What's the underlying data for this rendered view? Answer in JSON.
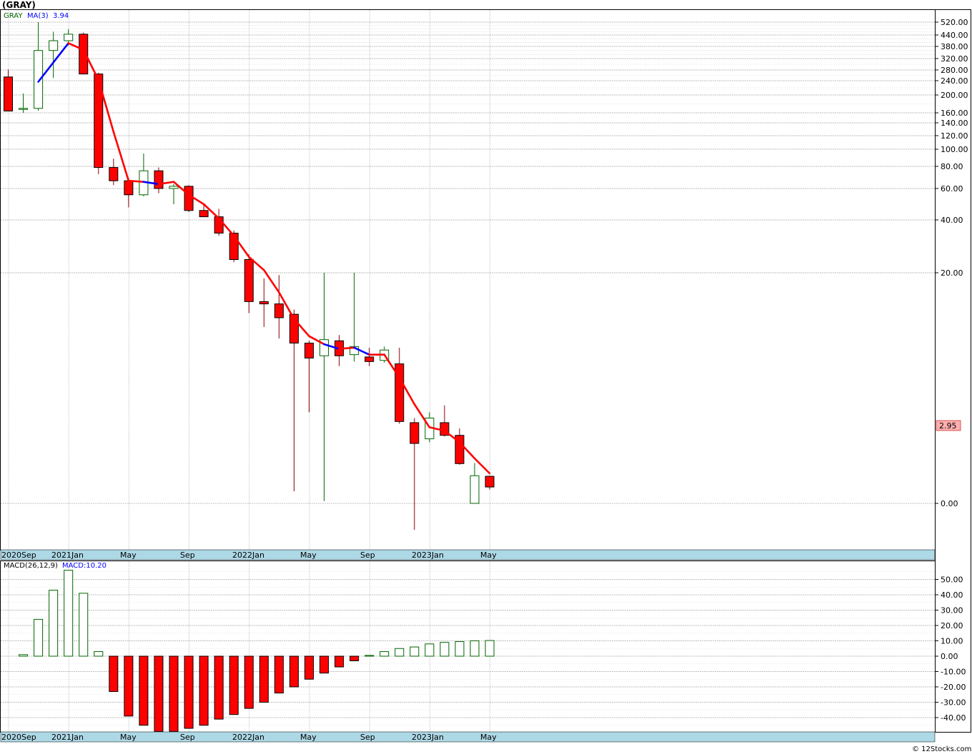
{
  "title": "(GRAY)",
  "legend": {
    "symbol": "GRAY",
    "ma_label": "MA(3)",
    "ma_value": "3.94"
  },
  "macd_legend": {
    "label": "MACD(26,12,9)",
    "value_label": "MACD:10.20"
  },
  "last_price_label": "2.95",
  "footer": "© 12Stocks.com",
  "colors": {
    "up": "#006400",
    "down": "#ff0000",
    "ma_up": "#0000ff",
    "ma_down": "#ff0000",
    "axis_band": "#add8e6",
    "grid": "#c8c8c8"
  },
  "chart_data": [
    {
      "type": "candlestick",
      "title": "(GRAY)",
      "y_tick_labels": [
        "520.00",
        "440.00",
        "380.00",
        "320.00",
        "280.00",
        "240.00",
        "200.00",
        "160.00",
        "140.00",
        "120.00",
        "100.00",
        "80.00",
        "60.00",
        "40.00",
        "20.00",
        "0.00"
      ],
      "x_tick_labels": [
        "2020Sep",
        "2021Jan",
        "May",
        "Sep",
        "2022Jan",
        "May",
        "Sep",
        "2023Jan",
        "May"
      ],
      "ma_label": "MA(3)",
      "candles": [
        {
          "period": "2020-09",
          "open": 254,
          "high": 282,
          "low": 164,
          "close": 164
        },
        {
          "period": "2020-10",
          "open": 170,
          "high": 204,
          "low": 160,
          "close": 170
        },
        {
          "period": "2020-11",
          "open": 170,
          "high": 520,
          "low": 165,
          "close": 360
        },
        {
          "period": "2020-12",
          "open": 360,
          "high": 460,
          "low": 250,
          "close": 410
        },
        {
          "period": "2021-01",
          "open": 410,
          "high": 476,
          "low": 385,
          "close": 445
        },
        {
          "period": "2021-02",
          "open": 445,
          "high": 455,
          "low": 265,
          "close": 265
        },
        {
          "period": "2021-03",
          "open": 265,
          "high": 270,
          "low": 73,
          "close": 79
        },
        {
          "period": "2021-04",
          "open": 79,
          "high": 89,
          "low": 63,
          "close": 67
        },
        {
          "period": "2021-05",
          "open": 67,
          "high": 69,
          "low": 48,
          "close": 56
        },
        {
          "period": "2021-06",
          "open": 56,
          "high": 95,
          "low": 55,
          "close": 76
        },
        {
          "period": "2021-07",
          "open": 76,
          "high": 79,
          "low": 57,
          "close": 60
        },
        {
          "period": "2021-08",
          "open": 60,
          "high": 64,
          "low": 50,
          "close": 62
        },
        {
          "period": "2021-09",
          "open": 62,
          "high": 63,
          "low": 45,
          "close": 46
        },
        {
          "period": "2021-10",
          "open": 46,
          "high": 50,
          "low": 42,
          "close": 42
        },
        {
          "period": "2021-11",
          "open": 42,
          "high": 47,
          "low": 34,
          "close": 35
        },
        {
          "period": "2021-12",
          "open": 35,
          "high": 36,
          "low": 24,
          "close": 25
        },
        {
          "period": "2022-01",
          "open": 25,
          "high": 27,
          "low": 16.5,
          "close": 17.5
        },
        {
          "period": "2022-02",
          "open": 17.5,
          "high": 19.5,
          "low": 15.3,
          "close": 17.3
        },
        {
          "period": "2022-03",
          "open": 17.3,
          "high": 19.8,
          "low": 14.3,
          "close": 16.1
        },
        {
          "period": "2022-04",
          "open": 16.4,
          "high": 16.8,
          "low": 1.05,
          "close": 13.9
        },
        {
          "period": "2022-05",
          "open": 13.9,
          "high": 14.1,
          "low": 7.9,
          "close": 12.6
        },
        {
          "period": "2022-06",
          "open": 12.8,
          "high": 20,
          "low": 0.2,
          "close": 14.2
        },
        {
          "period": "2022-07",
          "open": 14.1,
          "high": 14.6,
          "low": 11.9,
          "close": 12.8
        },
        {
          "period": "2022-08",
          "open": 12.9,
          "high": 20,
          "low": 12.3,
          "close": 13.6
        },
        {
          "period": "2022-09",
          "open": 12.7,
          "high": 13.5,
          "low": 11.9,
          "close": 12.3
        },
        {
          "period": "2022-10",
          "open": 12.4,
          "high": 13.6,
          "low": 12.2,
          "close": 13.3
        },
        {
          "period": "2022-11",
          "open": 12.1,
          "high": 13.5,
          "low": 6.9,
          "close": 7.1
        },
        {
          "period": "2022-12",
          "open": 7.0,
          "high": 7.4,
          "low": -0.35,
          "close": 5.2
        },
        {
          "period": "2023-01",
          "open": 5.6,
          "high": 7.9,
          "low": 5.3,
          "close": 7.4
        },
        {
          "period": "2023-02",
          "open": 7.0,
          "high": 8.5,
          "low": 5.8,
          "close": 5.9
        },
        {
          "period": "2023-03",
          "open": 5.9,
          "high": 6.5,
          "low": 3.35,
          "close": 3.45
        },
        {
          "period": "2023-04",
          "open": 0,
          "high": 3.5,
          "low": 0,
          "close": 2.4
        },
        {
          "period": "2023-05",
          "open": 2.35,
          "high": 2.4,
          "low": 1.2,
          "close": 1.42
        }
      ],
      "ma_points": [
        {
          "idx": 2,
          "value": 237,
          "color": "ma_up"
        },
        {
          "idx": 4,
          "value": 397,
          "color": "ma_up"
        },
        {
          "idx": 5,
          "value": 363,
          "color": "ma_down"
        },
        {
          "idx": 6,
          "value": 243,
          "color": "ma_down"
        },
        {
          "idx": 7,
          "value": 126,
          "color": "ma_down"
        },
        {
          "idx": 8,
          "value": 67,
          "color": "ma_down"
        },
        {
          "idx": 9,
          "value": 66,
          "color": "ma_down"
        },
        {
          "idx": 10,
          "value": 64,
          "color": "ma_up"
        },
        {
          "idx": 11,
          "value": 66,
          "color": "ma_down"
        },
        {
          "idx": 12,
          "value": 56,
          "color": "ma_down"
        },
        {
          "idx": 13,
          "value": 50,
          "color": "ma_down"
        },
        {
          "idx": 14,
          "value": 41,
          "color": "ma_down"
        },
        {
          "idx": 15,
          "value": 34,
          "color": "ma_down"
        },
        {
          "idx": 16,
          "value": 26,
          "color": "ma_down"
        },
        {
          "idx": 17,
          "value": 21,
          "color": "ma_down"
        },
        {
          "idx": 18,
          "value": 18.3,
          "color": "ma_down"
        },
        {
          "idx": 19,
          "value": 16.0,
          "color": "ma_down"
        },
        {
          "idx": 20,
          "value": 14.5,
          "color": "ma_down"
        },
        {
          "idx": 21,
          "value": 13.8,
          "color": "ma_down"
        },
        {
          "idx": 22,
          "value": 13.4,
          "color": "ma_up"
        },
        {
          "idx": 23,
          "value": 13.5,
          "color": "ma_down"
        },
        {
          "idx": 24,
          "value": 12.9,
          "color": "ma_up"
        },
        {
          "idx": 25,
          "value": 12.9,
          "color": "ma_down"
        },
        {
          "idx": 26,
          "value": 10.9,
          "color": "ma_down"
        },
        {
          "idx": 27,
          "value": 8.6,
          "color": "ma_down"
        },
        {
          "idx": 28,
          "value": 6.6,
          "color": "ma_down"
        },
        {
          "idx": 29,
          "value": 6.3,
          "color": "ma_down"
        },
        {
          "idx": 30,
          "value": 5.3,
          "color": "ma_down"
        },
        {
          "idx": 31,
          "value": 3.9,
          "color": "ma_down"
        },
        {
          "idx": 32,
          "value": 2.6,
          "color": "ma_down"
        }
      ]
    },
    {
      "type": "bar",
      "title": "MACD(26,12,9)",
      "y_tick_labels": [
        "50.00",
        "40.00",
        "30.00",
        "20.00",
        "10.00",
        "0.00",
        "-10.00",
        "-20.00",
        "-30.00",
        "-40.00"
      ],
      "ylim": [
        -48,
        57
      ],
      "x_tick_labels": [
        "2020Sep",
        "2021Jan",
        "May",
        "Sep",
        "2022Jan",
        "May",
        "Sep",
        "2023Jan",
        "May"
      ],
      "values": [
        0,
        1,
        24,
        43,
        56,
        41,
        3,
        -23,
        -39,
        -45,
        -49,
        -49,
        -47,
        -45,
        -41,
        -38,
        -34,
        -30,
        -24,
        -20,
        -15,
        -11,
        -7,
        -3,
        0.5,
        3,
        5,
        6,
        8,
        9,
        9.5,
        10,
        10.2
      ]
    }
  ]
}
